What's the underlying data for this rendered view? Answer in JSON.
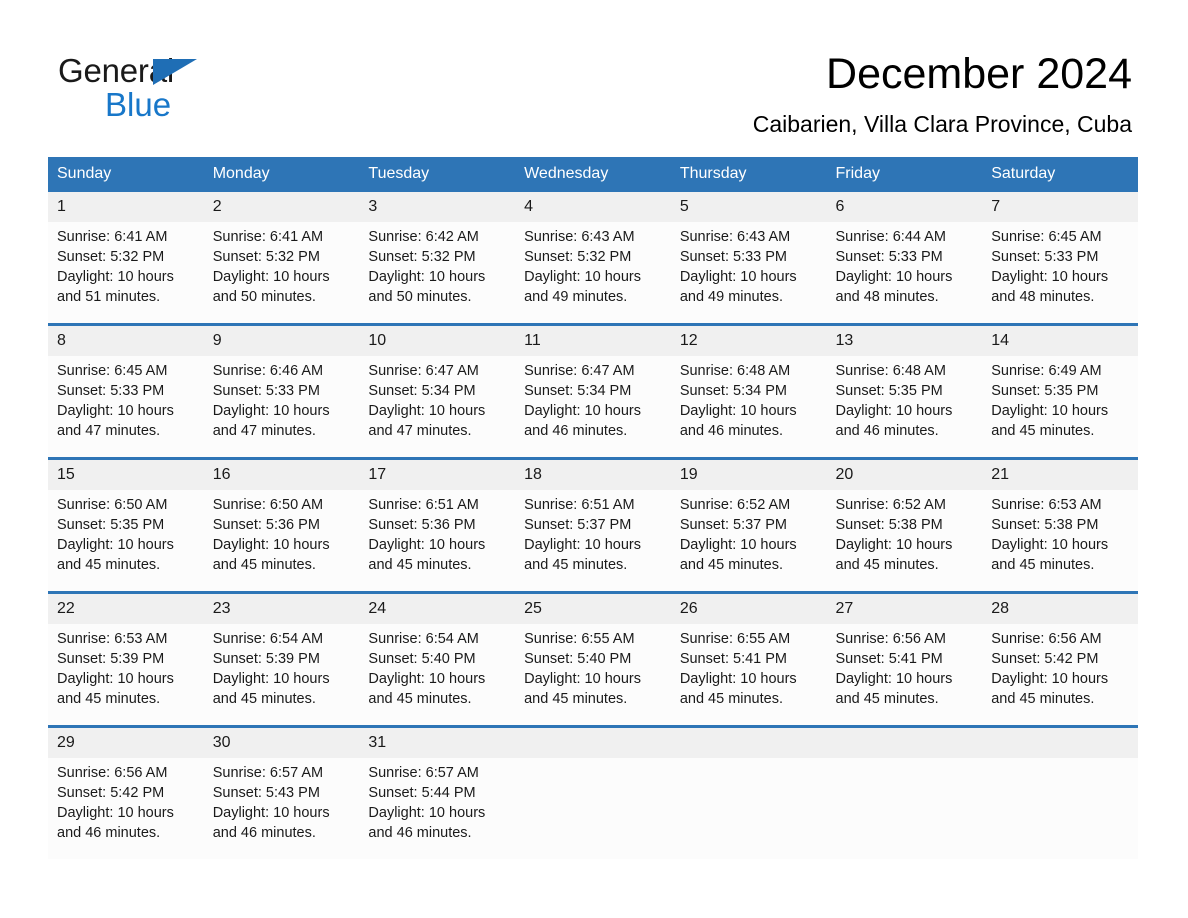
{
  "brand": {
    "name_part1": "General",
    "name_part2": "Blue",
    "logo_icon": "triangle-icon",
    "accent_color": "#1877c9"
  },
  "header": {
    "month_title": "December 2024",
    "location": "Caibarien, Villa Clara Province, Cuba"
  },
  "theme": {
    "header_blue": "#2e75b6",
    "row_separator_blue": "#2e75b6",
    "daynum_band_gray": "#f0f0f0"
  },
  "weekday_headers": [
    "Sunday",
    "Monday",
    "Tuesday",
    "Wednesday",
    "Thursday",
    "Friday",
    "Saturday"
  ],
  "labels": {
    "sunrise_prefix": "Sunrise:",
    "sunset_prefix": "Sunset:",
    "daylight_prefix": "Daylight:"
  },
  "weeks": [
    [
      {
        "day": "1",
        "sunrise": "Sunrise: 6:41 AM",
        "sunset": "Sunset: 5:32 PM",
        "daylight_line1": "Daylight: 10 hours",
        "daylight_line2": "and 51 minutes."
      },
      {
        "day": "2",
        "sunrise": "Sunrise: 6:41 AM",
        "sunset": "Sunset: 5:32 PM",
        "daylight_line1": "Daylight: 10 hours",
        "daylight_line2": "and 50 minutes."
      },
      {
        "day": "3",
        "sunrise": "Sunrise: 6:42 AM",
        "sunset": "Sunset: 5:32 PM",
        "daylight_line1": "Daylight: 10 hours",
        "daylight_line2": "and 50 minutes."
      },
      {
        "day": "4",
        "sunrise": "Sunrise: 6:43 AM",
        "sunset": "Sunset: 5:32 PM",
        "daylight_line1": "Daylight: 10 hours",
        "daylight_line2": "and 49 minutes."
      },
      {
        "day": "5",
        "sunrise": "Sunrise: 6:43 AM",
        "sunset": "Sunset: 5:33 PM",
        "daylight_line1": "Daylight: 10 hours",
        "daylight_line2": "and 49 minutes."
      },
      {
        "day": "6",
        "sunrise": "Sunrise: 6:44 AM",
        "sunset": "Sunset: 5:33 PM",
        "daylight_line1": "Daylight: 10 hours",
        "daylight_line2": "and 48 minutes."
      },
      {
        "day": "7",
        "sunrise": "Sunrise: 6:45 AM",
        "sunset": "Sunset: 5:33 PM",
        "daylight_line1": "Daylight: 10 hours",
        "daylight_line2": "and 48 minutes."
      }
    ],
    [
      {
        "day": "8",
        "sunrise": "Sunrise: 6:45 AM",
        "sunset": "Sunset: 5:33 PM",
        "daylight_line1": "Daylight: 10 hours",
        "daylight_line2": "and 47 minutes."
      },
      {
        "day": "9",
        "sunrise": "Sunrise: 6:46 AM",
        "sunset": "Sunset: 5:33 PM",
        "daylight_line1": "Daylight: 10 hours",
        "daylight_line2": "and 47 minutes."
      },
      {
        "day": "10",
        "sunrise": "Sunrise: 6:47 AM",
        "sunset": "Sunset: 5:34 PM",
        "daylight_line1": "Daylight: 10 hours",
        "daylight_line2": "and 47 minutes."
      },
      {
        "day": "11",
        "sunrise": "Sunrise: 6:47 AM",
        "sunset": "Sunset: 5:34 PM",
        "daylight_line1": "Daylight: 10 hours",
        "daylight_line2": "and 46 minutes."
      },
      {
        "day": "12",
        "sunrise": "Sunrise: 6:48 AM",
        "sunset": "Sunset: 5:34 PM",
        "daylight_line1": "Daylight: 10 hours",
        "daylight_line2": "and 46 minutes."
      },
      {
        "day": "13",
        "sunrise": "Sunrise: 6:48 AM",
        "sunset": "Sunset: 5:35 PM",
        "daylight_line1": "Daylight: 10 hours",
        "daylight_line2": "and 46 minutes."
      },
      {
        "day": "14",
        "sunrise": "Sunrise: 6:49 AM",
        "sunset": "Sunset: 5:35 PM",
        "daylight_line1": "Daylight: 10 hours",
        "daylight_line2": "and 45 minutes."
      }
    ],
    [
      {
        "day": "15",
        "sunrise": "Sunrise: 6:50 AM",
        "sunset": "Sunset: 5:35 PM",
        "daylight_line1": "Daylight: 10 hours",
        "daylight_line2": "and 45 minutes."
      },
      {
        "day": "16",
        "sunrise": "Sunrise: 6:50 AM",
        "sunset": "Sunset: 5:36 PM",
        "daylight_line1": "Daylight: 10 hours",
        "daylight_line2": "and 45 minutes."
      },
      {
        "day": "17",
        "sunrise": "Sunrise: 6:51 AM",
        "sunset": "Sunset: 5:36 PM",
        "daylight_line1": "Daylight: 10 hours",
        "daylight_line2": "and 45 minutes."
      },
      {
        "day": "18",
        "sunrise": "Sunrise: 6:51 AM",
        "sunset": "Sunset: 5:37 PM",
        "daylight_line1": "Daylight: 10 hours",
        "daylight_line2": "and 45 minutes."
      },
      {
        "day": "19",
        "sunrise": "Sunrise: 6:52 AM",
        "sunset": "Sunset: 5:37 PM",
        "daylight_line1": "Daylight: 10 hours",
        "daylight_line2": "and 45 minutes."
      },
      {
        "day": "20",
        "sunrise": "Sunrise: 6:52 AM",
        "sunset": "Sunset: 5:38 PM",
        "daylight_line1": "Daylight: 10 hours",
        "daylight_line2": "and 45 minutes."
      },
      {
        "day": "21",
        "sunrise": "Sunrise: 6:53 AM",
        "sunset": "Sunset: 5:38 PM",
        "daylight_line1": "Daylight: 10 hours",
        "daylight_line2": "and 45 minutes."
      }
    ],
    [
      {
        "day": "22",
        "sunrise": "Sunrise: 6:53 AM",
        "sunset": "Sunset: 5:39 PM",
        "daylight_line1": "Daylight: 10 hours",
        "daylight_line2": "and 45 minutes."
      },
      {
        "day": "23",
        "sunrise": "Sunrise: 6:54 AM",
        "sunset": "Sunset: 5:39 PM",
        "daylight_line1": "Daylight: 10 hours",
        "daylight_line2": "and 45 minutes."
      },
      {
        "day": "24",
        "sunrise": "Sunrise: 6:54 AM",
        "sunset": "Sunset: 5:40 PM",
        "daylight_line1": "Daylight: 10 hours",
        "daylight_line2": "and 45 minutes."
      },
      {
        "day": "25",
        "sunrise": "Sunrise: 6:55 AM",
        "sunset": "Sunset: 5:40 PM",
        "daylight_line1": "Daylight: 10 hours",
        "daylight_line2": "and 45 minutes."
      },
      {
        "day": "26",
        "sunrise": "Sunrise: 6:55 AM",
        "sunset": "Sunset: 5:41 PM",
        "daylight_line1": "Daylight: 10 hours",
        "daylight_line2": "and 45 minutes."
      },
      {
        "day": "27",
        "sunrise": "Sunrise: 6:56 AM",
        "sunset": "Sunset: 5:41 PM",
        "daylight_line1": "Daylight: 10 hours",
        "daylight_line2": "and 45 minutes."
      },
      {
        "day": "28",
        "sunrise": "Sunrise: 6:56 AM",
        "sunset": "Sunset: 5:42 PM",
        "daylight_line1": "Daylight: 10 hours",
        "daylight_line2": "and 45 minutes."
      }
    ],
    [
      {
        "day": "29",
        "sunrise": "Sunrise: 6:56 AM",
        "sunset": "Sunset: 5:42 PM",
        "daylight_line1": "Daylight: 10 hours",
        "daylight_line2": "and 46 minutes."
      },
      {
        "day": "30",
        "sunrise": "Sunrise: 6:57 AM",
        "sunset": "Sunset: 5:43 PM",
        "daylight_line1": "Daylight: 10 hours",
        "daylight_line2": "and 46 minutes."
      },
      {
        "day": "31",
        "sunrise": "Sunrise: 6:57 AM",
        "sunset": "Sunset: 5:44 PM",
        "daylight_line1": "Daylight: 10 hours",
        "daylight_line2": "and 46 minutes."
      },
      {
        "day": "",
        "sunrise": "",
        "sunset": "",
        "daylight_line1": "",
        "daylight_line2": ""
      },
      {
        "day": "",
        "sunrise": "",
        "sunset": "",
        "daylight_line1": "",
        "daylight_line2": ""
      },
      {
        "day": "",
        "sunrise": "",
        "sunset": "",
        "daylight_line1": "",
        "daylight_line2": ""
      },
      {
        "day": "",
        "sunrise": "",
        "sunset": "",
        "daylight_line1": "",
        "daylight_line2": ""
      }
    ]
  ]
}
